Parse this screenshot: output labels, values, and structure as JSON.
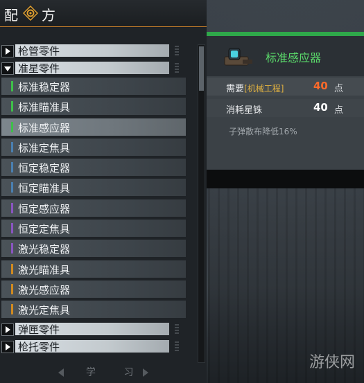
{
  "header": {
    "title_left": "配",
    "title_right": "方",
    "icon": "gear-cog-icon",
    "accent": "#c07a2a"
  },
  "categories": [
    {
      "label": "枪管零件",
      "expanded": false
    },
    {
      "label": "准星零件",
      "expanded": true
    },
    {
      "label": "弹匣零件",
      "expanded": false
    },
    {
      "label": "枪托零件",
      "expanded": false
    }
  ],
  "items": [
    {
      "label": "标准稳定器",
      "color": "#3fbf4a"
    },
    {
      "label": "标准瞄准具",
      "color": "#3fbf4a"
    },
    {
      "label": "标准感应器",
      "color": "#3fbf4a",
      "selected": true
    },
    {
      "label": "标准定焦具",
      "color": "#4a7fb0"
    },
    {
      "label": "恒定稳定器",
      "color": "#4a7fb0"
    },
    {
      "label": "恒定瞄准具",
      "color": "#4a7fb0"
    },
    {
      "label": "恒定感应器",
      "color": "#8a55c0"
    },
    {
      "label": "恒定定焦具",
      "color": "#8a55c0"
    },
    {
      "label": "激光稳定器",
      "color": "#8a55c0"
    },
    {
      "label": "激光瞄准具",
      "color": "#d08a20"
    },
    {
      "label": "激光感应器",
      "color": "#d08a20"
    },
    {
      "label": "激光定焦具",
      "color": "#d08a20"
    }
  ],
  "footer": {
    "label": "学 习"
  },
  "detail": {
    "name": "标准感应器",
    "name_color": "#5ad96a",
    "icon": "sensor-device-icon",
    "require_label": "需要",
    "require_tag": "[机械工程]",
    "require_value": "40",
    "require_unit": "点",
    "require_value_color": "#ff6a2a",
    "cost_label": "消耗星铢",
    "cost_value": "40",
    "cost_unit": "点",
    "description": "子弹散布降低16%"
  },
  "watermark": "游侠网"
}
